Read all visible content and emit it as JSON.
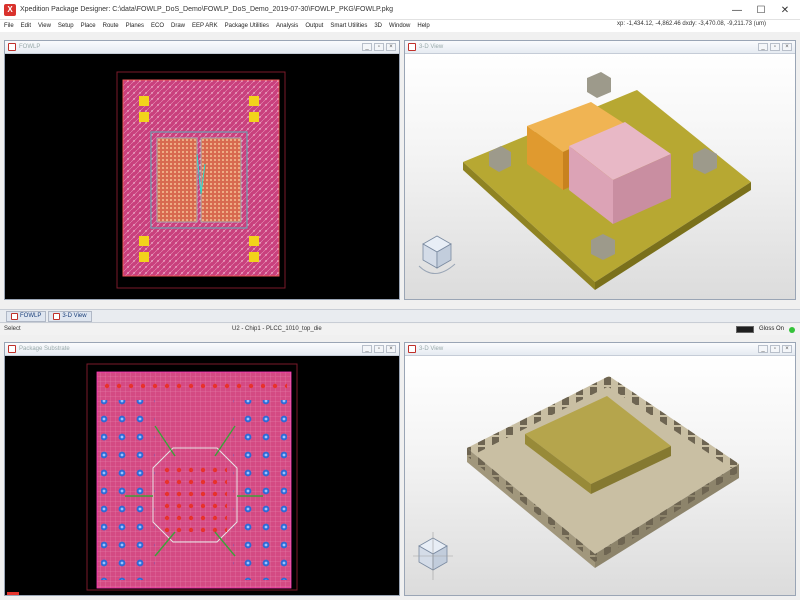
{
  "window": {
    "title": "Xpedition Package Designer: C:\\data\\FOWLP_DoS_Demo\\FOWLP_DoS_Demo_2019-07-30\\FOWLP_PKG\\FOWLP.pkg",
    "coord_readout": "xp: -1,434.12, -4,862.46 dxdy: -3,470.08, -9,211.73 (um)",
    "controls": [
      "—",
      "☐",
      "✕"
    ]
  },
  "menu": {
    "items": [
      "File",
      "Edit",
      "View",
      "Setup",
      "Place",
      "Route",
      "Planes",
      "ECO",
      "Draw",
      "EEP ARK",
      "Package Utilities",
      "Analysis",
      "Output",
      "Smart Utilities",
      "3D",
      "Window",
      "Help"
    ]
  },
  "panels": {
    "top_left": {
      "title": "FOWLP"
    },
    "top_right": {
      "title": "3-D View"
    },
    "bottom_left": {
      "title": "Package Substrate"
    },
    "bottom_right": {
      "title": "3-D View"
    }
  },
  "doc_tabs": [
    {
      "label": "FOWLP"
    },
    {
      "label": "3-D View"
    }
  ],
  "status": {
    "left": "Select",
    "center": "U2 - Chip1 - PLCC_1010_top_die",
    "gloss_label": "Gloss On"
  },
  "colors": {
    "substrate_pink": "#c9407d",
    "pcb_bg": "#000000",
    "board_yellow": "#b7a832",
    "die_orange": "#e09a2f",
    "die_pink": "#dca3b6",
    "plcc_tan": "#b9ad8d",
    "accent_red": "#d9322d"
  }
}
